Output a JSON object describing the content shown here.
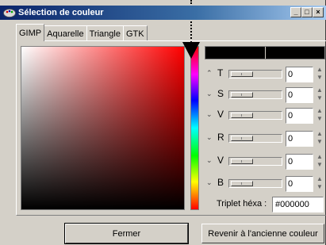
{
  "window": {
    "title": "Sélection de couleur",
    "controls": {
      "minimize": "_",
      "maximize": "□",
      "close": "×"
    }
  },
  "tabs": [
    {
      "label": "GIMP",
      "active": true
    },
    {
      "label": "Aquarelle",
      "active": false
    },
    {
      "label": "Triangle",
      "active": false
    },
    {
      "label": "GTK",
      "active": false
    }
  ],
  "sliders": [
    {
      "label": "T",
      "value": "0"
    },
    {
      "label": "S",
      "value": "0"
    },
    {
      "label": "V",
      "value": "0"
    },
    {
      "label": "R",
      "value": "0"
    },
    {
      "label": "V",
      "value": "0"
    },
    {
      "label": "B",
      "value": "0"
    }
  ],
  "hex": {
    "label": "Triplet héxa :",
    "value": "#000000"
  },
  "buttons": {
    "close": "Fermer",
    "revert": "Revenir à l'ancienne couleur"
  },
  "colors": {
    "current": "#000000",
    "previous": "#000000",
    "hue": "#ff0000"
  }
}
